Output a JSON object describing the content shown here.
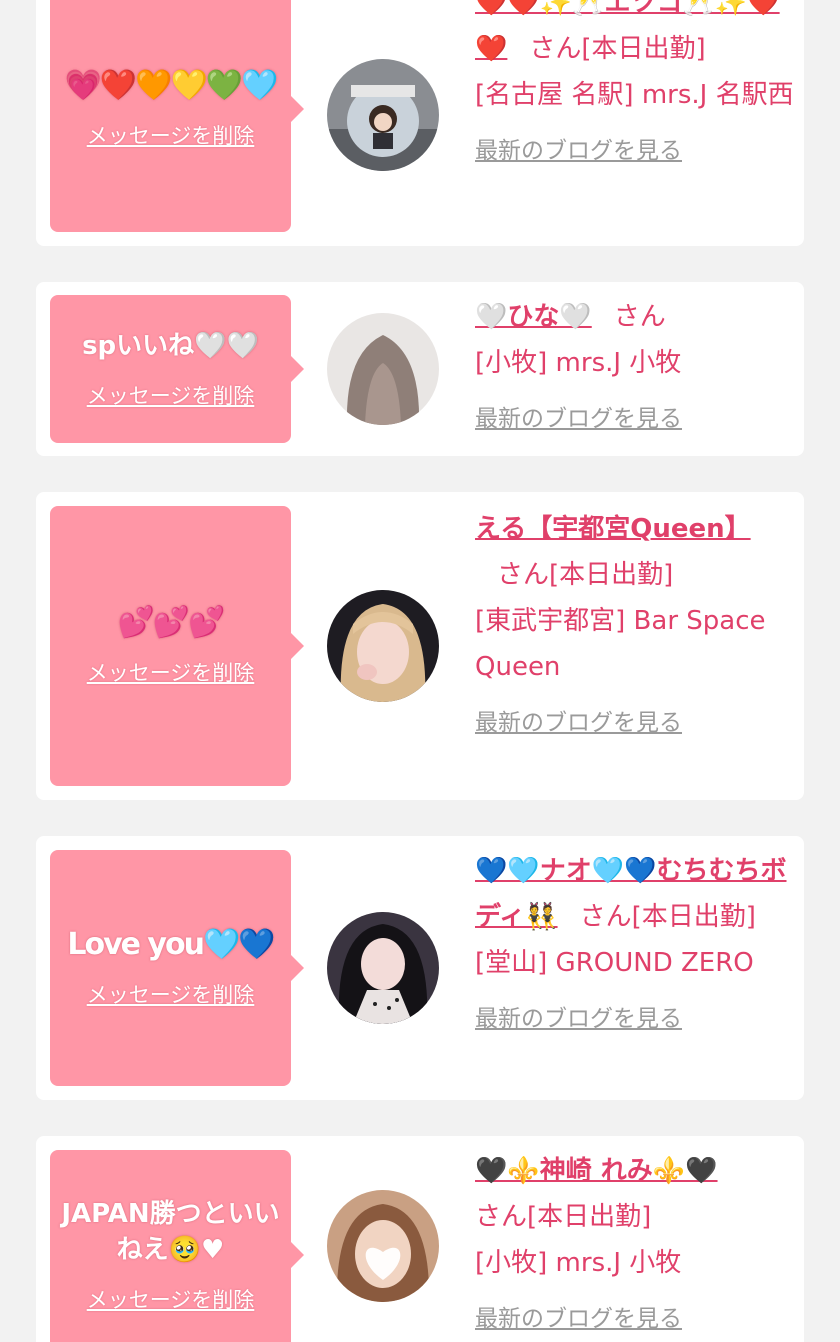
{
  "delete_label": "メッセージを削除",
  "blog_label": "最新のブログを見る",
  "san_label": "さん",
  "cards": [
    {
      "message": "💗❤️🧡💛💚🩵",
      "name": "❤️❤️✨🥂エツコ🥂✨❤️❤️",
      "status": "[本日出勤]",
      "shop": "[名古屋 名駅] mrs.J 名駅西",
      "avatar_icon": "gachapon-doll-photo"
    },
    {
      "message": "spいいね🤍🤍",
      "name": "🤍ひな🤍",
      "status": "",
      "shop": "[小牧] mrs.J 小牧",
      "avatar_icon": "long-hair-photo"
    },
    {
      "message": "💕💕💕",
      "name": "える【宇都宮Queen】",
      "status": "[本日出勤]",
      "shop": "[東武宇都宮] Bar Space Queen",
      "avatar_icon": "blonde-woman-photo"
    },
    {
      "message": "Love you🩵💙",
      "name": "💙🩵ナオ🩵💙むちむちボディ👯",
      "status": "[本日出勤]",
      "shop": "[堂山] GROUND ZERO",
      "avatar_icon": "dark-hair-woman-photo"
    },
    {
      "message": "JAPAN勝つといいねえ🥹♥",
      "name": "🖤⚜️神崎 れみ⚜️🖤",
      "status": "[本日出勤]",
      "shop": "[小牧] mrs.J 小牧",
      "avatar_icon": "heart-covered-face-photo"
    }
  ]
}
